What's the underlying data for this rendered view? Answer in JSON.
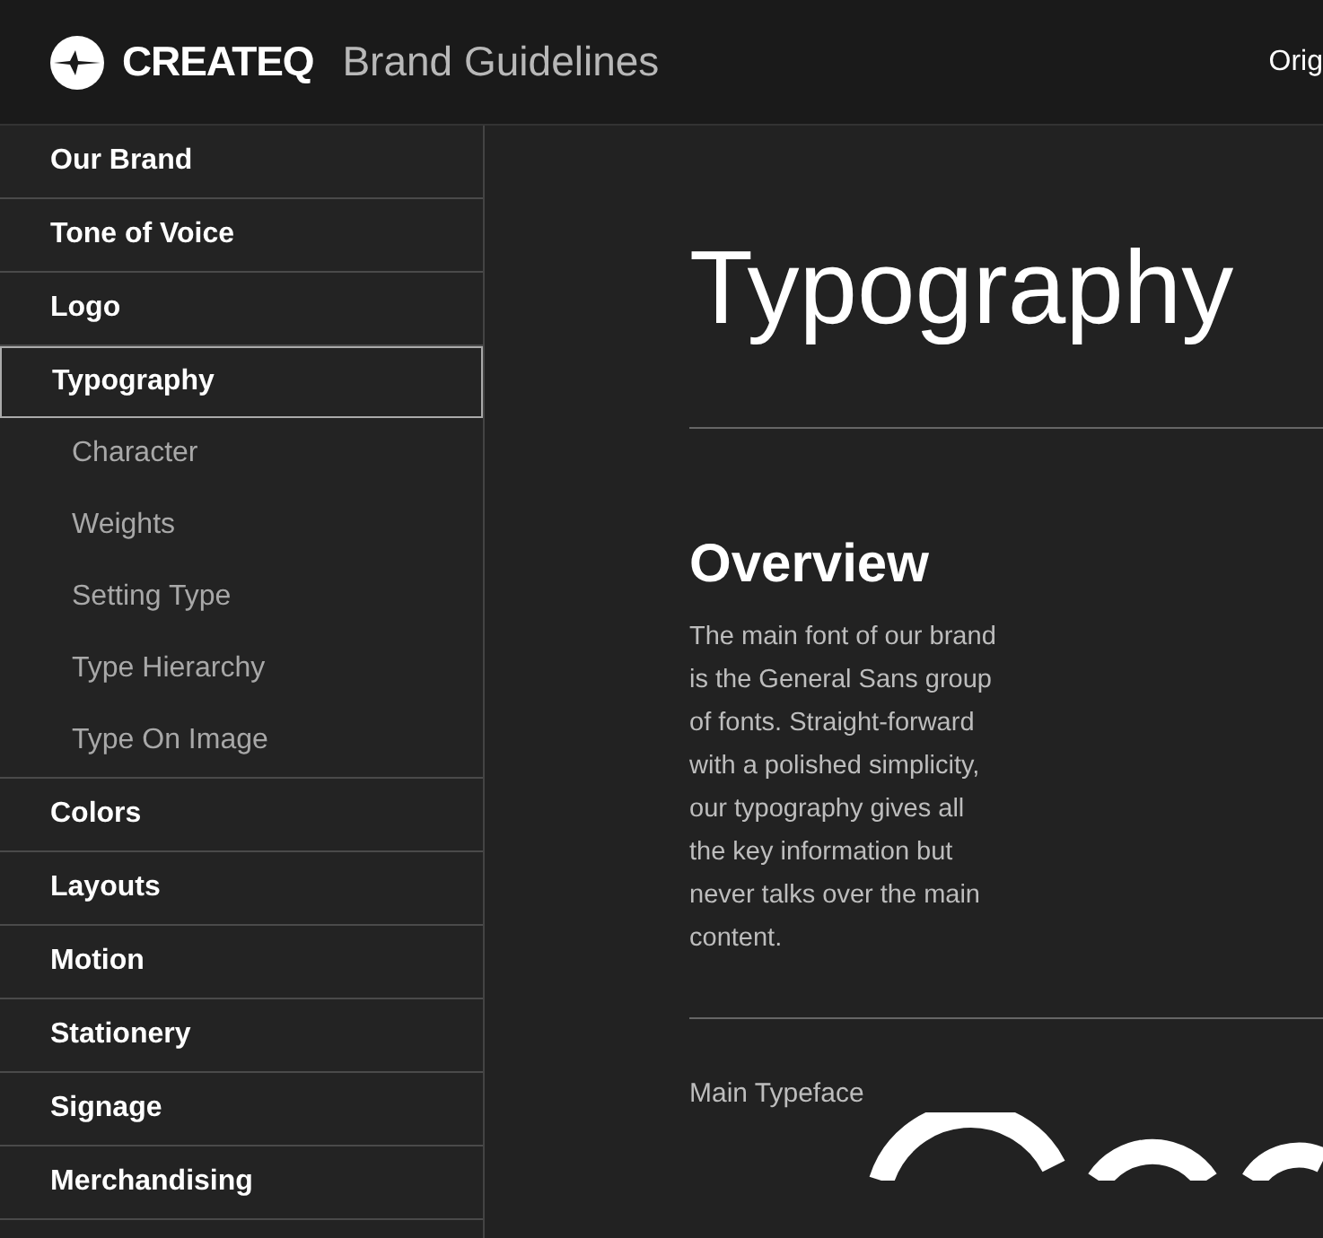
{
  "header": {
    "brand": "CREATEQ",
    "title": "Brand Guidelines",
    "nav_link": "Orig"
  },
  "sidebar": {
    "items": [
      {
        "label": "Our Brand",
        "selected": false
      },
      {
        "label": "Tone of Voice",
        "selected": false
      },
      {
        "label": "Logo",
        "selected": false
      },
      {
        "label": "Typography",
        "selected": true,
        "children": [
          {
            "label": "Character",
            "selected": false
          },
          {
            "label": "Weights",
            "selected": false
          },
          {
            "label": "Setting Type",
            "selected": false
          },
          {
            "label": "Type Hierarchy",
            "selected": false
          },
          {
            "label": "Type On Image",
            "selected": false
          }
        ]
      },
      {
        "label": "Colors",
        "selected": false
      },
      {
        "label": "Layouts",
        "selected": false
      },
      {
        "label": "Motion",
        "selected": false
      },
      {
        "label": "Stationery",
        "selected": false
      },
      {
        "label": "Signage",
        "selected": false
      },
      {
        "label": "Merchandising",
        "selected": false
      }
    ]
  },
  "main": {
    "heading": "Typography",
    "section_title": "Overview",
    "paragraph": "The main font of our brand is the General Sans group of fonts. Straight-forward with a polished simplicity, our typography gives all the key information but never talks over the main content.",
    "specimen_label": "Main Typeface"
  }
}
